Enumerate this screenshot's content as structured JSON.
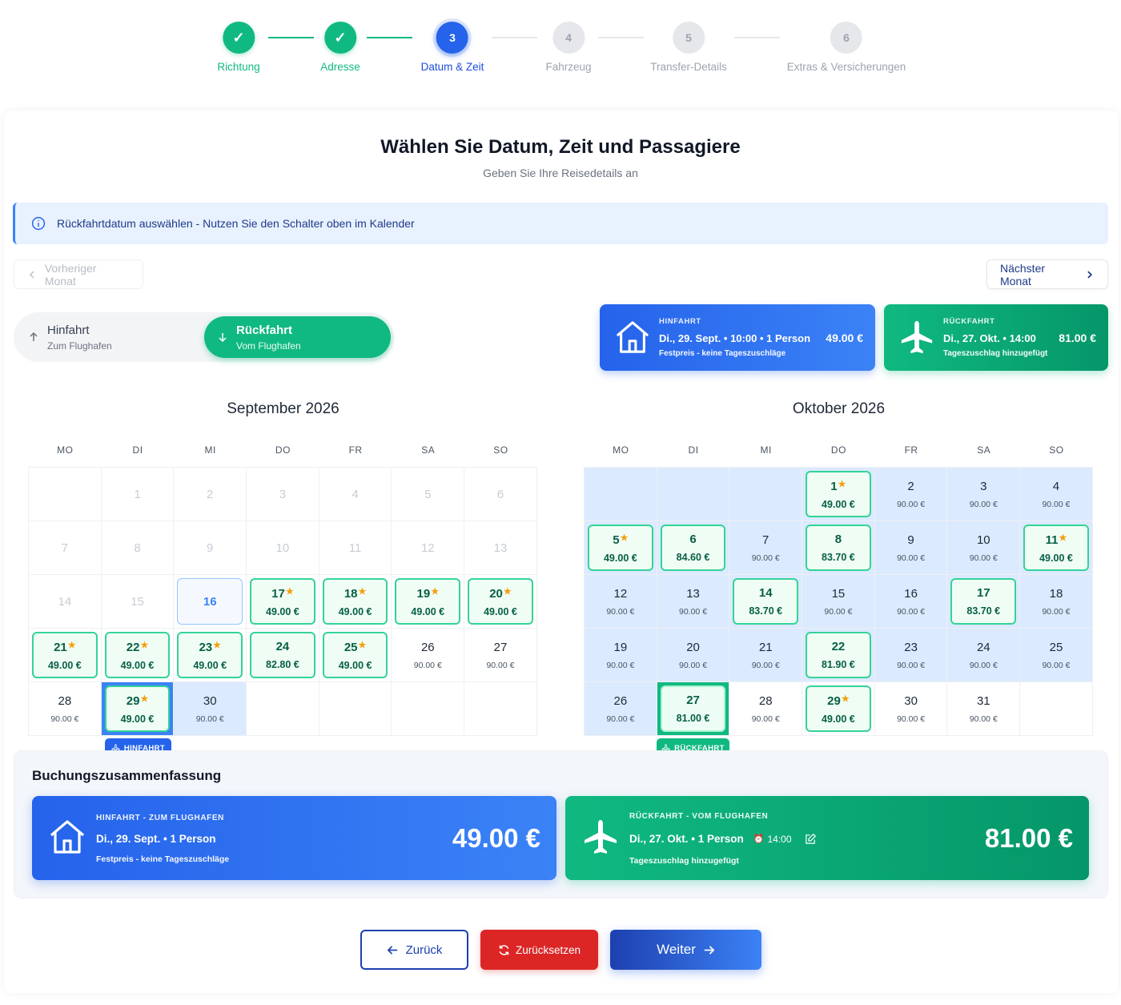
{
  "stepper": {
    "steps": [
      {
        "num": "✓",
        "label": "Richtung"
      },
      {
        "num": "✓",
        "label": "Adresse"
      },
      {
        "num": "3",
        "label": "Datum & Zeit"
      },
      {
        "num": "4",
        "label": "Fahrzeug"
      },
      {
        "num": "5",
        "label": "Transfer-Details"
      },
      {
        "num": "6",
        "label": "Extras & Versicherungen"
      }
    ]
  },
  "header": {
    "title": "Wählen Sie Datum, Zeit und Passagiere",
    "subtitle": "Geben Sie Ihre Reisedetails an"
  },
  "info": {
    "text": "Rückfahrtdatum auswählen - Nutzen Sie den Schalter oben im Kalender"
  },
  "nav": {
    "prev": "Vorheriger Monat",
    "next": "Nächster Monat"
  },
  "toggle": {
    "outbound": {
      "label": "Hinfahrt",
      "sub": "Zum Flughafen"
    },
    "return": {
      "label": "Rückfahrt",
      "sub": "Vom Flughafen"
    }
  },
  "mini_outbound": {
    "label": "HINFAHRT",
    "detail": "Di., 29. Sept. • 10:00 • 1 Person",
    "price": "49.00 €",
    "note": "Festpreis - keine Tageszuschläge"
  },
  "mini_return": {
    "label": "RÜCKFAHRT",
    "detail": "Di., 27. Okt. • 14:00",
    "price": "81.00 €",
    "note": "Tageszuschlag hinzugefügt"
  },
  "calendar": {
    "weekdays": [
      "MO",
      "DI",
      "MI",
      "DO",
      "FR",
      "SA",
      "SO"
    ],
    "september": {
      "title": "September 2026",
      "cells": [
        {
          "d": "",
          "p": "",
          "s": "empty"
        },
        {
          "d": "1",
          "p": "",
          "s": "past"
        },
        {
          "d": "2",
          "p": "",
          "s": "past"
        },
        {
          "d": "3",
          "p": "",
          "s": "past"
        },
        {
          "d": "4",
          "p": "",
          "s": "past"
        },
        {
          "d": "5",
          "p": "",
          "s": "past"
        },
        {
          "d": "6",
          "p": "",
          "s": "past"
        },
        {
          "d": "7",
          "p": "",
          "s": "past"
        },
        {
          "d": "8",
          "p": "",
          "s": "past"
        },
        {
          "d": "9",
          "p": "",
          "s": "past"
        },
        {
          "d": "10",
          "p": "",
          "s": "past"
        },
        {
          "d": "11",
          "p": "",
          "s": "past"
        },
        {
          "d": "12",
          "p": "",
          "s": "past"
        },
        {
          "d": "13",
          "p": "",
          "s": "past"
        },
        {
          "d": "14",
          "p": "",
          "s": "past"
        },
        {
          "d": "15",
          "p": "",
          "s": "past"
        },
        {
          "d": "16",
          "p": "",
          "s": "today"
        },
        {
          "d": "17",
          "p": "49.00 €",
          "s": "special",
          "star": true
        },
        {
          "d": "18",
          "p": "49.00 €",
          "s": "special",
          "star": true
        },
        {
          "d": "19",
          "p": "49.00 €",
          "s": "special",
          "star": true
        },
        {
          "d": "20",
          "p": "49.00 €",
          "s": "special",
          "star": true
        },
        {
          "d": "21",
          "p": "49.00 €",
          "s": "special",
          "star": true
        },
        {
          "d": "22",
          "p": "49.00 €",
          "s": "special",
          "star": true
        },
        {
          "d": "23",
          "p": "49.00 €",
          "s": "special",
          "star": true
        },
        {
          "d": "24",
          "p": "82.80 €",
          "s": "special"
        },
        {
          "d": "25",
          "p": "49.00 €",
          "s": "special",
          "star": true
        },
        {
          "d": "26",
          "p": "90.00 €",
          "s": "normal"
        },
        {
          "d": "27",
          "p": "90.00 €",
          "s": "normal"
        },
        {
          "d": "28",
          "p": "90.00 €",
          "s": "normal"
        },
        {
          "d": "29",
          "p": "49.00 €",
          "s": "sel-out",
          "star": true
        },
        {
          "d": "30",
          "p": "90.00 €",
          "s": "range"
        },
        {
          "d": "",
          "p": "",
          "s": "empty"
        },
        {
          "d": "",
          "p": "",
          "s": "empty"
        },
        {
          "d": "",
          "p": "",
          "s": "empty"
        },
        {
          "d": "",
          "p": "",
          "s": "empty"
        }
      ]
    },
    "october": {
      "title": "Oktober 2026",
      "cells": [
        {
          "d": "",
          "p": "",
          "s": "range"
        },
        {
          "d": "",
          "p": "",
          "s": "range"
        },
        {
          "d": "",
          "p": "",
          "s": "range"
        },
        {
          "d": "1",
          "p": "49.00 €",
          "s": "special range",
          "star": true
        },
        {
          "d": "2",
          "p": "90.00 €",
          "s": "range"
        },
        {
          "d": "3",
          "p": "90.00 €",
          "s": "range"
        },
        {
          "d": "4",
          "p": "90.00 €",
          "s": "range"
        },
        {
          "d": "5",
          "p": "49.00 €",
          "s": "special range",
          "star": true
        },
        {
          "d": "6",
          "p": "84.60 €",
          "s": "special range"
        },
        {
          "d": "7",
          "p": "90.00 €",
          "s": "range"
        },
        {
          "d": "8",
          "p": "83.70 €",
          "s": "special range"
        },
        {
          "d": "9",
          "p": "90.00 €",
          "s": "range"
        },
        {
          "d": "10",
          "p": "90.00 €",
          "s": "range"
        },
        {
          "d": "11",
          "p": "49.00 €",
          "s": "special range",
          "star": true
        },
        {
          "d": "12",
          "p": "90.00 €",
          "s": "range"
        },
        {
          "d": "13",
          "p": "90.00 €",
          "s": "range"
        },
        {
          "d": "14",
          "p": "83.70 €",
          "s": "special range"
        },
        {
          "d": "15",
          "p": "90.00 €",
          "s": "range"
        },
        {
          "d": "16",
          "p": "90.00 €",
          "s": "range"
        },
        {
          "d": "17",
          "p": "83.70 €",
          "s": "special range"
        },
        {
          "d": "18",
          "p": "90.00 €",
          "s": "range"
        },
        {
          "d": "19",
          "p": "90.00 €",
          "s": "range"
        },
        {
          "d": "20",
          "p": "90.00 €",
          "s": "range"
        },
        {
          "d": "21",
          "p": "90.00 €",
          "s": "range"
        },
        {
          "d": "22",
          "p": "81.90 €",
          "s": "special range"
        },
        {
          "d": "23",
          "p": "90.00 €",
          "s": "range"
        },
        {
          "d": "24",
          "p": "90.00 €",
          "s": "range"
        },
        {
          "d": "25",
          "p": "90.00 €",
          "s": "range"
        },
        {
          "d": "26",
          "p": "90.00 €",
          "s": "range"
        },
        {
          "d": "27",
          "p": "81.00 €",
          "s": "sel-ret"
        },
        {
          "d": "28",
          "p": "90.00 €",
          "s": "normal"
        },
        {
          "d": "29",
          "p": "49.00 €",
          "s": "special",
          "star": true
        },
        {
          "d": "30",
          "p": "90.00 €",
          "s": "normal"
        },
        {
          "d": "31",
          "p": "90.00 €",
          "s": "normal"
        },
        {
          "d": "",
          "p": "",
          "s": "empty"
        }
      ]
    },
    "tag_outbound": "HINFAHRT",
    "tag_return": "RÜCKFAHRT"
  },
  "summary": {
    "title": "Buchungszusammenfassung",
    "outbound": {
      "label": "HINFAHRT - ZUM FLUGHAFEN",
      "detail": "Di., 29. Sept. • 1 Person",
      "note": "Festpreis - keine Tageszuschläge",
      "price": "49.00 €"
    },
    "return": {
      "label": "RÜCKFAHRT - VOM FLUGHAFEN",
      "detail": "Di., 27. Okt. • 1 Person",
      "time": "14:00",
      "note": "Tageszuschlag hinzugefügt",
      "price": "81.00 €"
    }
  },
  "buttons": {
    "back": "Zurück",
    "reset": "Zurücksetzen",
    "next": "Weiter"
  },
  "colors": {
    "blue": "#2563eb",
    "green": "#10b981",
    "red": "#dc2626",
    "range": "#dbeafe"
  }
}
